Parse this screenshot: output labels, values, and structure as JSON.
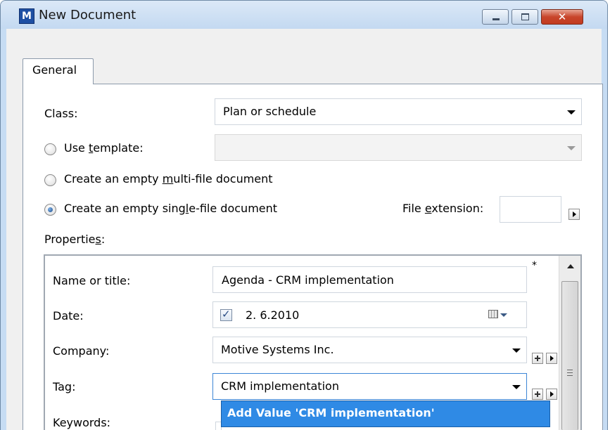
{
  "window": {
    "title": "New Document",
    "icon_letter": "M",
    "close_glyph": "✕"
  },
  "tabs": [
    {
      "label": "General"
    }
  ],
  "form": {
    "class_label": "Class:",
    "class_value": "Plan or schedule",
    "use_template_pre": "Use ",
    "use_template_key": "t",
    "use_template_post": "emplate:",
    "multi_pre": "Create an empty ",
    "multi_key": "m",
    "multi_post": "ulti-file document",
    "single_pre": "Create an empty sing",
    "single_key": "l",
    "single_post": "e-file document",
    "selected_option": "single-file",
    "file_ext_pre": "File ",
    "file_ext_key": "e",
    "file_ext_post": "xtension:",
    "file_ext_value": "",
    "properties_pre": "Propertie",
    "properties_key": "s",
    "properties_post": ":"
  },
  "properties": {
    "name_label": "Name or title:",
    "name_value": "Agenda - CRM implementation",
    "required_mark": "*",
    "date_label": "Date:",
    "date_checked": true,
    "date_value": "2.  6.2010",
    "company_label": "Company:",
    "company_value": "Motive Systems Inc.",
    "tag_label": "Tag:",
    "tag_value": "CRM implementation",
    "keywords_label": "Keywords:"
  },
  "autocomplete": {
    "suggestion": "Add Value 'CRM implementation'"
  },
  "colors": {
    "selection": "#2f8ae5",
    "titlebar": "#c6dcf3",
    "close_button": "#c8462c"
  }
}
